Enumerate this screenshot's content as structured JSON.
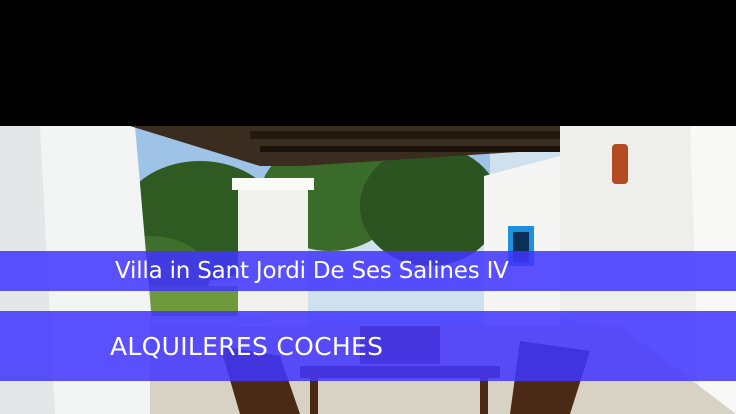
{
  "listing": {
    "title": "Villa in Sant Jordi De Ses Salines IV"
  },
  "category": {
    "label": "ALQUILERES COCHES"
  },
  "colors": {
    "band": "#4034ff",
    "top_bar": "#000000"
  }
}
